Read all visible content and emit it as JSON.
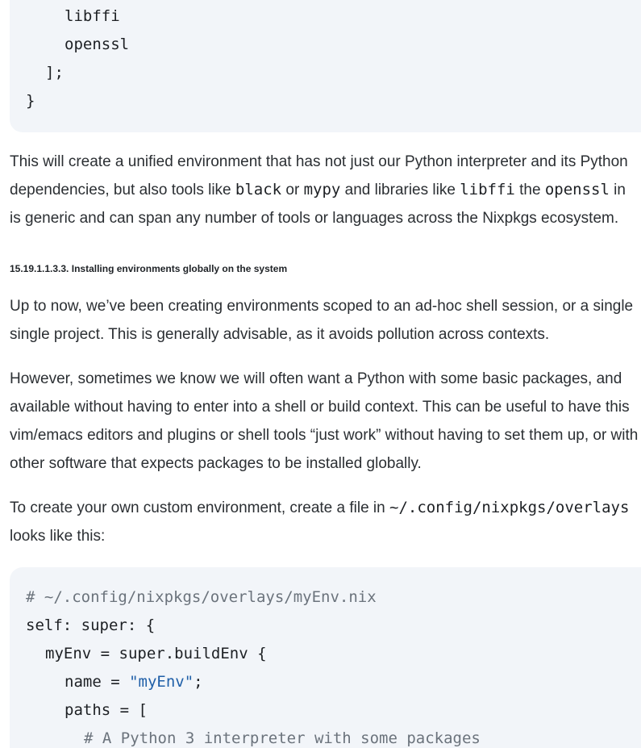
{
  "code_top": {
    "lines": [
      "libffi",
      "openssl",
      "];",
      "}"
    ]
  },
  "para1": {
    "l1": "This will create a unified environment that has not just our Python interpreter and its Python",
    "l2_a": "dependencies, but also tools like ",
    "l2_code1": "black",
    "l2_b": " or ",
    "l2_code2": "mypy",
    "l2_c": " and libraries like ",
    "l2_code3": "libffi",
    "l2_d": " the ",
    "l2_code4": "openssl",
    "l2_e": " in",
    "l3": "is generic and can span any number of tools or languages across the Nixpkgs ecosystem."
  },
  "heading": "15.19.1.1.3.3. Installing environments globally on the system",
  "para2": {
    "l1": "Up to now, we’ve been creating environments scoped to an ad-hoc shell session, or a single",
    "l2": "single project. This is generally advisable, as it avoids pollution across contexts."
  },
  "para3": {
    "l1": "However, sometimes we know we will often want a Python with some basic packages, and",
    "l2": "available without having to enter into a shell or build context. This can be useful to have this",
    "l3": "vim/emacs editors and plugins or shell tools “just work” without having to set them up, or with",
    "l4": "other software that expects packages to be installed globally."
  },
  "para4": {
    "l1_a": "To create your own custom environment, create a file in ",
    "l1_code": "~/.config/nixpkgs/overlays",
    "l2": "looks like this:"
  },
  "code_bottom": {
    "l1_comment": "# ~/.config/nixpkgs/overlays/myEnv.nix",
    "l2": "self: super: {",
    "l3": "myEnv = super.buildEnv {",
    "l4_a": "name = ",
    "l4_str": "\"myEnv\"",
    "l4_b": ";",
    "l5": "paths = [",
    "l6_comment": "# A Python 3 interpreter with some packages"
  }
}
